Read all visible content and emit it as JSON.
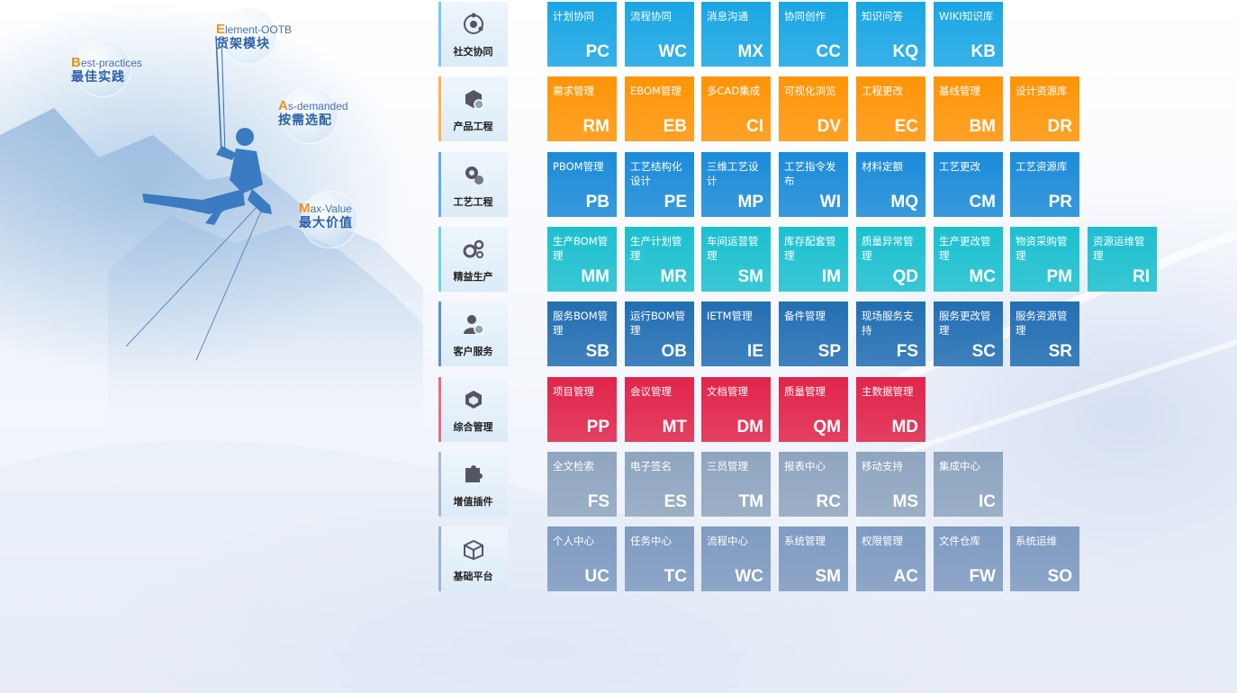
{
  "left_tags": [
    {
      "initial": "B",
      "rest": "est-practices",
      "zh": "最佳实践"
    },
    {
      "initial": "E",
      "rest": "lement-OOTB",
      "zh": "货架模块"
    },
    {
      "initial": "A",
      "rest": "s-demanded",
      "zh": "按需选配"
    },
    {
      "initial": "M",
      "rest": "ax-Value",
      "zh": "最大价值"
    }
  ],
  "colors": {
    "blue_light": "#19a6e6",
    "orange": "#ff9406",
    "blue": "#1a8ad8",
    "cyan": "#18bfcf",
    "navy": "#236fb2",
    "red": "#e3244a",
    "gray": "#8fa6c0",
    "slate": "#7f9bc0"
  },
  "rows": [
    {
      "label": "社交协同",
      "icon": "social-collaboration-icon",
      "color": "#1aa6e4",
      "bar": "#7cc8f0",
      "tiles": [
        {
          "name": "计划协同",
          "abbr": "PC"
        },
        {
          "name": "流程协同",
          "abbr": "WC"
        },
        {
          "name": "消息沟通",
          "abbr": "MX"
        },
        {
          "name": "协同创作",
          "abbr": "CC"
        },
        {
          "name": "知识问答",
          "abbr": "KQ"
        },
        {
          "name": "WIKI知识库",
          "abbr": "KB"
        }
      ]
    },
    {
      "label": "产品工程",
      "icon": "product-engineering-icon",
      "color": "#ff9406",
      "bar": "#ffb449",
      "tiles": [
        {
          "name": "需求管理",
          "abbr": "RM"
        },
        {
          "name": "EBOM管理",
          "abbr": "EB"
        },
        {
          "name": "多CAD集成",
          "abbr": "CI"
        },
        {
          "name": "可视化浏览",
          "abbr": "DV"
        },
        {
          "name": "工程更改",
          "abbr": "EC"
        },
        {
          "name": "基线管理",
          "abbr": "BM"
        },
        {
          "name": "设计资源库",
          "abbr": "DR"
        }
      ]
    },
    {
      "label": "工艺工程",
      "icon": "process-engineering-icon",
      "color": "#1b8bd8",
      "bar": "#5fb0e8",
      "tiles": [
        {
          "name": "PBOM管理",
          "abbr": "PB"
        },
        {
          "name": "工艺结构化设计",
          "abbr": "PE"
        },
        {
          "name": "三维工艺设计",
          "abbr": "MP"
        },
        {
          "name": "工艺指令发布",
          "abbr": "WI"
        },
        {
          "name": "材料定额",
          "abbr": "MQ"
        },
        {
          "name": "工艺更改",
          "abbr": "CM"
        },
        {
          "name": "工艺资源库",
          "abbr": "PR"
        }
      ]
    },
    {
      "label": "精益生产",
      "icon": "lean-production-icon",
      "color": "#1cc0cf",
      "bar": "#6ad8e0",
      "tiles": [
        {
          "name": "生产BOM管理",
          "abbr": "MM"
        },
        {
          "name": "生产计划管理",
          "abbr": "MR"
        },
        {
          "name": "车间运营管理",
          "abbr": "SM"
        },
        {
          "name": "库存配套管理",
          "abbr": "IM"
        },
        {
          "name": "质量异常管理",
          "abbr": "QD"
        },
        {
          "name": "生产更改管理",
          "abbr": "MC"
        },
        {
          "name": "物资采购管理",
          "abbr": "PM"
        },
        {
          "name": "资源运维管理",
          "abbr": "RI"
        }
      ]
    },
    {
      "label": "客户服务",
      "icon": "customer-service-icon",
      "color": "#236fb3",
      "bar": "#5b93cc",
      "tiles": [
        {
          "name": "服务BOM管理",
          "abbr": "SB"
        },
        {
          "name": "运行BOM管理",
          "abbr": "OB"
        },
        {
          "name": "IETM管理",
          "abbr": "IE"
        },
        {
          "name": "备件管理",
          "abbr": "SP"
        },
        {
          "name": "现场服务支持",
          "abbr": "FS"
        },
        {
          "name": "服务更改管理",
          "abbr": "SC"
        },
        {
          "name": "服务资源管理",
          "abbr": "SR"
        }
      ]
    },
    {
      "label": "综合管理",
      "icon": "integrated-management-icon",
      "color": "#e2244a",
      "bar": "#ec6b85",
      "tiles": [
        {
          "name": "项目管理",
          "abbr": "PP"
        },
        {
          "name": "会议管理",
          "abbr": "MT"
        },
        {
          "name": "文档管理",
          "abbr": "DM"
        },
        {
          "name": "质量管理",
          "abbr": "QM"
        },
        {
          "name": "主数据管理",
          "abbr": "MD"
        }
      ]
    },
    {
      "label": "增值插件",
      "icon": "plugin-icon",
      "color": "#8fa5bf",
      "bar": "#a9bad0",
      "tiles": [
        {
          "name": "全文检索",
          "abbr": "FS"
        },
        {
          "name": "电子签名",
          "abbr": "ES"
        },
        {
          "name": "三员管理",
          "abbr": "TM"
        },
        {
          "name": "报表中心",
          "abbr": "RC"
        },
        {
          "name": "移动支持",
          "abbr": "MS"
        },
        {
          "name": "集成中心",
          "abbr": "IC"
        }
      ]
    },
    {
      "label": "基础平台",
      "icon": "base-platform-icon",
      "color": "#7f9bc1",
      "bar": "#9db3d2",
      "tiles": [
        {
          "name": "个人中心",
          "abbr": "UC"
        },
        {
          "name": "任务中心",
          "abbr": "TC"
        },
        {
          "name": "流程中心",
          "abbr": "WC"
        },
        {
          "name": "系统管理",
          "abbr": "SM"
        },
        {
          "name": "权限管理",
          "abbr": "AC"
        },
        {
          "name": "文件仓库",
          "abbr": "FW"
        },
        {
          "name": "系统运维",
          "abbr": "SO"
        }
      ]
    }
  ]
}
